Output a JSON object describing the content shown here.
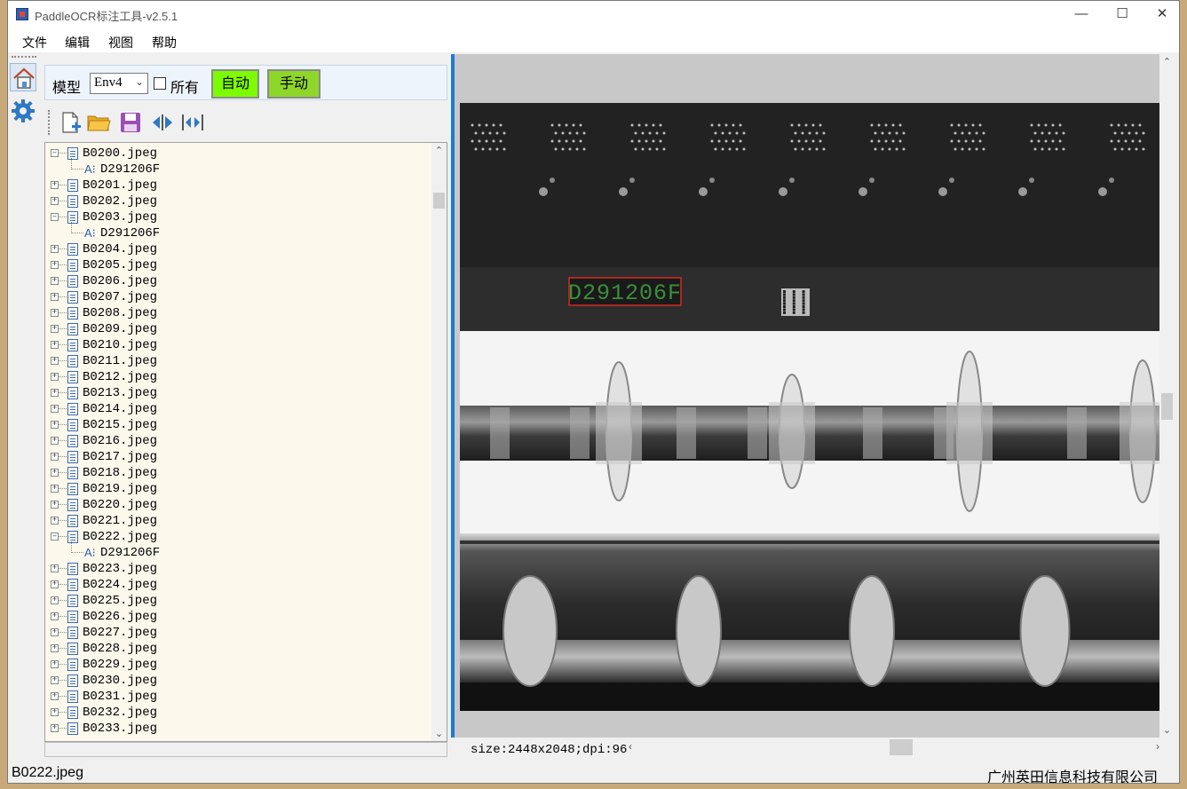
{
  "window": {
    "title": "PaddleOCR标注工具-v2.5.1"
  },
  "menu": [
    "文件",
    "编辑",
    "视图",
    "帮助"
  ],
  "dock": {
    "model_label": "模型",
    "model_value": "Env4",
    "all_label": "所有",
    "auto_label": "自动",
    "manual_label": "手动"
  },
  "tree": {
    "items": [
      {
        "name": "B0200.jpeg",
        "expanded": true,
        "label": "D291206F"
      },
      {
        "name": "B0201.jpeg"
      },
      {
        "name": "B0202.jpeg"
      },
      {
        "name": "B0203.jpeg",
        "expanded": true,
        "label": "D291206F"
      },
      {
        "name": "B0204.jpeg"
      },
      {
        "name": "B0205.jpeg"
      },
      {
        "name": "B0206.jpeg"
      },
      {
        "name": "B0207.jpeg"
      },
      {
        "name": "B0208.jpeg"
      },
      {
        "name": "B0209.jpeg"
      },
      {
        "name": "B0210.jpeg"
      },
      {
        "name": "B0211.jpeg"
      },
      {
        "name": "B0212.jpeg"
      },
      {
        "name": "B0213.jpeg"
      },
      {
        "name": "B0214.jpeg"
      },
      {
        "name": "B0215.jpeg"
      },
      {
        "name": "B0216.jpeg"
      },
      {
        "name": "B0217.jpeg"
      },
      {
        "name": "B0218.jpeg"
      },
      {
        "name": "B0219.jpeg"
      },
      {
        "name": "B0220.jpeg"
      },
      {
        "name": "B0221.jpeg"
      },
      {
        "name": "B0222.jpeg",
        "expanded": true,
        "label": "D291206F"
      },
      {
        "name": "B0223.jpeg"
      },
      {
        "name": "B0224.jpeg"
      },
      {
        "name": "B0225.jpeg"
      },
      {
        "name": "B0226.jpeg"
      },
      {
        "name": "B0227.jpeg"
      },
      {
        "name": "B0228.jpeg"
      },
      {
        "name": "B0229.jpeg"
      },
      {
        "name": "B0230.jpeg"
      },
      {
        "name": "B0231.jpeg"
      },
      {
        "name": "B0232.jpeg"
      },
      {
        "name": "B0233.jpeg"
      }
    ]
  },
  "canvas": {
    "ocr_text": "D291206F",
    "size_info": "size:2448x2048;dpi:96"
  },
  "status": {
    "current_file": "B0222.jpeg",
    "company": "广州英田信息科技有限公司"
  },
  "colors": {
    "accent": "#1e78d6",
    "auto_button": "#7dfc00",
    "manual_button": "#8fd62a",
    "tree_bg": "#fdf8ec",
    "box_stroke": "#d42a1e"
  }
}
